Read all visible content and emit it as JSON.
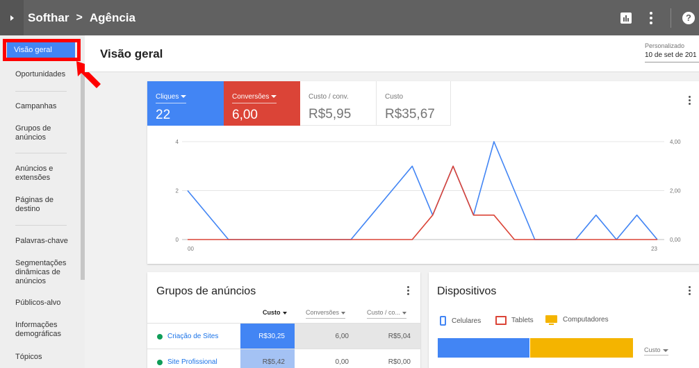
{
  "topbar": {
    "account": "Softhar",
    "separator": ">",
    "client": "Agência",
    "help": "?"
  },
  "sidebar": {
    "items": [
      {
        "label": "Visão geral"
      },
      {
        "label": "Oportunidades"
      },
      {
        "label": "Campanhas"
      },
      {
        "label": "Grupos de anúncios"
      },
      {
        "label": "Anúncios e extensões"
      },
      {
        "label": "Páginas de destino"
      },
      {
        "label": "Palavras-chave"
      },
      {
        "label": "Segmentações dinâmicas de anúncios"
      },
      {
        "label": "Públicos-alvo"
      },
      {
        "label": "Informações demográficas"
      },
      {
        "label": "Tópicos"
      }
    ]
  },
  "header": {
    "title": "Visão geral",
    "date_label": "Personalizado",
    "date_value": "10 de set de 201"
  },
  "metrics": [
    {
      "label": "Cliques",
      "value": "22",
      "color": "#4285f4"
    },
    {
      "label": "Conversões",
      "value": "6,00",
      "color": "#db4437"
    },
    {
      "label": "Custo / conv.",
      "value": "R$5,95"
    },
    {
      "label": "Custo",
      "value": "R$35,67"
    }
  ],
  "chart_data": {
    "type": "line",
    "x": [
      0,
      1,
      2,
      3,
      4,
      5,
      6,
      7,
      8,
      9,
      10,
      11,
      12,
      13,
      14,
      15,
      16,
      17,
      18,
      19,
      20,
      21,
      22,
      23
    ],
    "xtick_labels": [
      "00",
      "23"
    ],
    "series": [
      {
        "name": "Cliques",
        "color": "#4285f4",
        "axis": "left",
        "values": [
          2,
          1,
          0,
          0,
          0,
          0,
          0,
          0,
          0,
          1,
          2,
          3,
          1,
          3,
          1,
          4,
          2,
          0,
          0,
          0,
          1,
          0,
          1,
          0
        ]
      },
      {
        "name": "Conversões",
        "color": "#db4437",
        "axis": "right",
        "values": [
          0,
          0,
          0,
          0,
          0,
          0,
          0,
          0,
          0,
          0,
          0,
          0,
          1,
          3,
          1,
          1,
          0,
          0,
          0,
          0,
          0,
          0,
          0,
          0
        ]
      }
    ],
    "ylim_left": [
      0,
      4
    ],
    "ylim_right": [
      0,
      4
    ],
    "left_ticks": [
      "0",
      "2",
      "4"
    ],
    "right_ticks": [
      "0,00",
      "2,00",
      "4,00"
    ],
    "grid": true
  },
  "groups": {
    "title": "Grupos de anúncios",
    "columns": [
      "Custo",
      "Conversões",
      "Custo / co..."
    ],
    "rows": [
      {
        "name": "Criação de Sites",
        "cost": "R$30,25",
        "conv": "6,00",
        "cpa": "R$5,04",
        "cost_share": 0.848
      },
      {
        "name": "Site Profissional",
        "cost": "R$5,42",
        "conv": "0,00",
        "cpa": "R$0,00",
        "cost_share": 0.152
      }
    ]
  },
  "devices": {
    "title": "Dispositivos",
    "legend": [
      "Celulares",
      "Tablets",
      "Computadores"
    ],
    "share": {
      "mobile": 0.47,
      "tablet": 0.0,
      "desktop": 0.53
    },
    "metric": "Custo"
  }
}
